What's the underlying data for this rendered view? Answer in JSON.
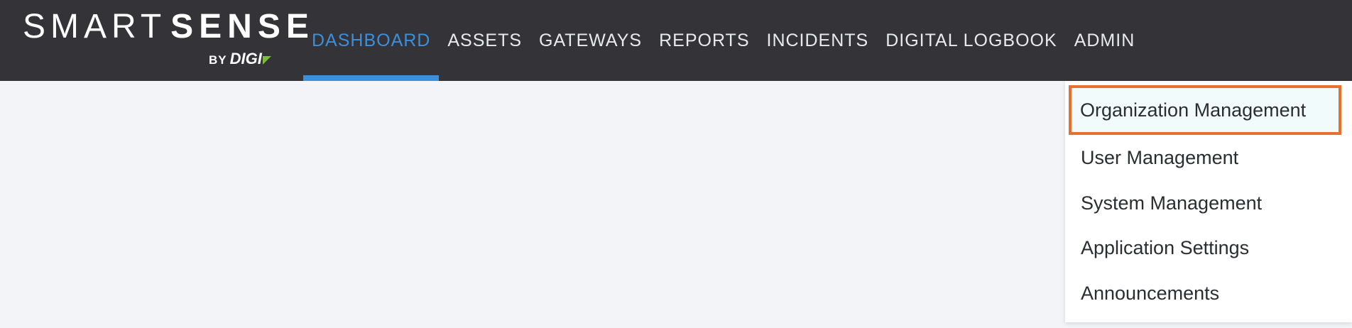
{
  "brand": {
    "name_part1": "SMART",
    "name_part2": "SENSE",
    "by": "BY",
    "company": "DIGI",
    "mark_color": "#7dbb3a"
  },
  "nav": {
    "items": [
      {
        "label": "DASHBOARD",
        "active": true
      },
      {
        "label": "ASSETS",
        "active": false
      },
      {
        "label": "GATEWAYS",
        "active": false
      },
      {
        "label": "REPORTS",
        "active": false
      },
      {
        "label": "INCIDENTS",
        "active": false
      },
      {
        "label": "DIGITAL LOGBOOK",
        "active": false
      },
      {
        "label": "ADMIN",
        "active": false
      }
    ]
  },
  "admin_menu": {
    "items": [
      {
        "label": "Organization Management",
        "highlighted": true
      },
      {
        "label": "User Management",
        "highlighted": false
      },
      {
        "label": "System Management",
        "highlighted": false
      },
      {
        "label": "Application Settings",
        "highlighted": false
      },
      {
        "label": "Announcements",
        "highlighted": false
      }
    ]
  },
  "colors": {
    "topbar": "#343438",
    "accent": "#3b8fdb",
    "highlight_border": "#e8702e",
    "page_bg": "#f2f4f7"
  }
}
